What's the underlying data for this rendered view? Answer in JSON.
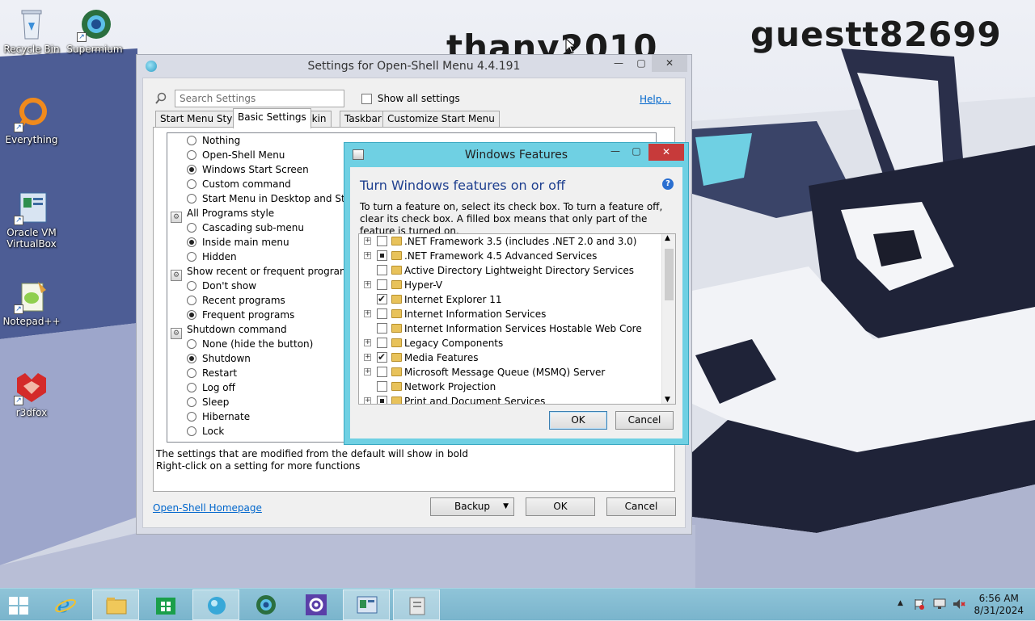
{
  "wallpaper": {
    "text_left": "thany2010",
    "text_right": "guestt82699"
  },
  "desktop_icons": [
    {
      "label": "Recycle Bin",
      "icon": "recycle-bin-icon"
    },
    {
      "label": "Supermium",
      "icon": "supermium-browser-icon"
    },
    {
      "label": "Everything",
      "icon": "everything-search-icon"
    },
    {
      "label": "Oracle VM VirtualBox",
      "icon": "virtualbox-icon"
    },
    {
      "label": "Notepad++",
      "icon": "notepadpp-icon"
    },
    {
      "label": "r3dfox",
      "icon": "r3dfox-icon"
    }
  ],
  "settings": {
    "title": "Settings for Open-Shell Menu 4.4.191",
    "search_placeholder": "Search Settings",
    "show_all_label": "Show all settings",
    "help_link": "Help...",
    "tabs": [
      "Start Menu Style",
      "Basic Settings",
      "Skin",
      "Taskbar",
      "Customize Start Menu"
    ],
    "active_tab": "Basic Settings",
    "tree": [
      {
        "type": "radio",
        "label": "Nothing",
        "checked": false
      },
      {
        "type": "radio",
        "label": "Open-Shell Menu",
        "checked": false
      },
      {
        "type": "radio",
        "label": "Windows Start Screen",
        "checked": true
      },
      {
        "type": "radio",
        "label": "Custom command",
        "checked": false
      },
      {
        "type": "radio",
        "label": "Start Menu in Desktop and Start S",
        "checked": false
      },
      {
        "type": "group",
        "label": "All Programs style"
      },
      {
        "type": "radio",
        "label": "Cascading sub-menu",
        "checked": false
      },
      {
        "type": "radio",
        "label": "Inside main menu",
        "checked": true
      },
      {
        "type": "radio",
        "label": "Hidden",
        "checked": false
      },
      {
        "type": "group",
        "label": "Show recent or frequent programs"
      },
      {
        "type": "radio",
        "label": "Don't show",
        "checked": false
      },
      {
        "type": "radio",
        "label": "Recent programs",
        "checked": false
      },
      {
        "type": "radio",
        "label": "Frequent programs",
        "checked": true
      },
      {
        "type": "group",
        "label": "Shutdown command"
      },
      {
        "type": "radio",
        "label": "None (hide the button)",
        "checked": false
      },
      {
        "type": "radio",
        "label": "Shutdown",
        "checked": true
      },
      {
        "type": "radio",
        "label": "Restart",
        "checked": false
      },
      {
        "type": "radio",
        "label": "Log off",
        "checked": false
      },
      {
        "type": "radio",
        "label": "Sleep",
        "checked": false
      },
      {
        "type": "radio",
        "label": "Hibernate",
        "checked": false
      },
      {
        "type": "radio",
        "label": "Lock",
        "checked": false
      }
    ],
    "hint_line1": "The settings that are modified from the default will show in bold",
    "hint_line2": "Right-click on a setting for more functions",
    "homepage_link": "Open-Shell Homepage",
    "backup_label": "Backup",
    "ok_label": "OK",
    "cancel_label": "Cancel"
  },
  "features": {
    "title": "Windows Features",
    "heading": "Turn Windows features on or off",
    "description": "To turn a feature on, select its check box. To turn a feature off, clear its check box. A filled box means that only part of the feature is turned on.",
    "items": [
      {
        "label": ".NET Framework 3.5 (includes .NET 2.0 and 3.0)",
        "state": "unchecked",
        "expandable": true
      },
      {
        "label": ".NET Framework 4.5 Advanced Services",
        "state": "partial",
        "expandable": true
      },
      {
        "label": "Active Directory Lightweight Directory Services",
        "state": "unchecked",
        "expandable": false
      },
      {
        "label": "Hyper-V",
        "state": "unchecked",
        "expandable": true
      },
      {
        "label": "Internet Explorer 11",
        "state": "checked",
        "expandable": false
      },
      {
        "label": "Internet Information Services",
        "state": "unchecked",
        "expandable": true
      },
      {
        "label": "Internet Information Services Hostable Web Core",
        "state": "unchecked",
        "expandable": false
      },
      {
        "label": "Legacy Components",
        "state": "unchecked",
        "expandable": true
      },
      {
        "label": "Media Features",
        "state": "checked",
        "expandable": true
      },
      {
        "label": "Microsoft Message Queue (MSMQ) Server",
        "state": "unchecked",
        "expandable": true
      },
      {
        "label": "Network Projection",
        "state": "unchecked",
        "expandable": false
      },
      {
        "label": "Print and Document Services",
        "state": "partial",
        "expandable": true
      }
    ],
    "ok_label": "OK",
    "cancel_label": "Cancel"
  },
  "taskbar": {
    "buttons": [
      "start-button-icon",
      "internet-explorer-icon",
      "file-explorer-icon",
      "store-icon",
      "open-shell-icon",
      "supermium-icon",
      "settings-gear-icon",
      "virtualbox-icon",
      "windows-features-icon"
    ],
    "time": "6:56 AM",
    "date": "8/31/2024"
  }
}
